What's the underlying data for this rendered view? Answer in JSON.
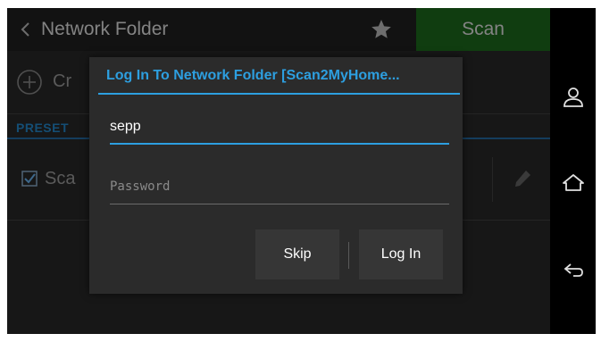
{
  "topbar": {
    "title": "Network Folder",
    "scan_label": "Scan",
    "back_icon": "chevron-left-icon",
    "star_icon": "star-icon"
  },
  "list": {
    "create_label": "Cr",
    "presets_header": "PRESET",
    "scan_item_label": "Sca",
    "scan_item_checked": true
  },
  "dialog": {
    "title": "Log In To Network Folder [Scan2MyHome...",
    "username_value": "sepp",
    "password_placeholder": "Password",
    "skip_label": "Skip",
    "login_label": "Log In"
  },
  "navbar": {
    "icons": [
      "user-icon",
      "home-icon",
      "back-arrow-icon"
    ]
  },
  "colors": {
    "accent": "#2d9fe0",
    "scan_button": "#1a5f1a",
    "presets_text": "#1f78b4"
  }
}
